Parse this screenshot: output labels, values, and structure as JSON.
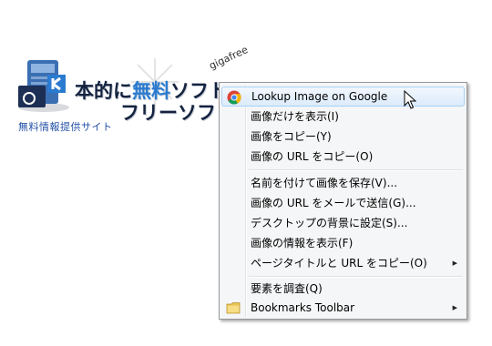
{
  "site": {
    "logo_line1_a": "本的に",
    "logo_line1_b": "無料",
    "logo_line1_c": "ソフト",
    "logo_line2": "フリーソフト",
    "url_fragment": "gigafree",
    "tagline": "無料情報提供サイト"
  },
  "menu": {
    "items": [
      {
        "label": "Lookup Image on Google",
        "icon": "chrome-google-icon",
        "highlighted": true
      },
      {
        "label": "画像だけを表示(I)"
      },
      {
        "label": "画像をコピー(Y)"
      },
      {
        "label": "画像の URL をコピー(O)"
      },
      {
        "label": "名前を付けて画像を保存(V)..."
      },
      {
        "label": "画像の URL をメールで送信(G)..."
      },
      {
        "label": "デスクトップの背景に設定(S)..."
      },
      {
        "label": "画像の情報を表示(F)"
      },
      {
        "label": "ページタイトルと URL をコピー(O)",
        "submenu": true
      },
      {
        "label": "要素を調査(Q)"
      },
      {
        "label": "Bookmarks Toolbar",
        "icon": "folder-icon",
        "submenu": true
      }
    ],
    "submenu_arrow": "▶"
  },
  "colors": {
    "menu_bg": "#f5f6f7",
    "highlight": "#dcebfc",
    "logo_text": "#13223f",
    "logo_accent": "#2a7bd0",
    "tagline": "#2552a8"
  }
}
